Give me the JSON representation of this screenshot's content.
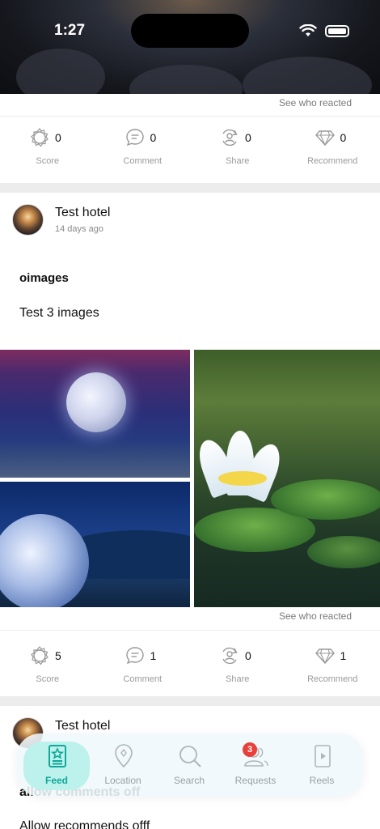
{
  "status_bar": {
    "time": "1:27"
  },
  "post1": {
    "see_who_reacted": "See who reacted",
    "reactions": [
      {
        "label": "Score",
        "count": "0",
        "icon": "score-badge-icon"
      },
      {
        "label": "Comment",
        "count": "0",
        "icon": "comment-icon"
      },
      {
        "label": "Share",
        "count": "0",
        "icon": "share-icon"
      },
      {
        "label": "Recommend",
        "count": "0",
        "icon": "diamond-icon"
      }
    ]
  },
  "post2": {
    "author": "Test hotel",
    "time": "14 days ago",
    "title": "oimages",
    "text": "Test 3 images",
    "see_who_reacted": "See who reacted",
    "reactions": [
      {
        "label": "Score",
        "count": "5",
        "icon": "score-badge-icon"
      },
      {
        "label": "Comment",
        "count": "1",
        "icon": "comment-icon"
      },
      {
        "label": "Share",
        "count": "0",
        "icon": "share-icon"
      },
      {
        "label": "Recommend",
        "count": "1",
        "icon": "diamond-icon"
      }
    ]
  },
  "post3": {
    "author": "Test hotel",
    "title": "allow comments off",
    "text": "Allow recommends offf"
  },
  "bottom_nav": {
    "items": [
      {
        "label": "Feed",
        "icon": "feed-star-icon",
        "active": true
      },
      {
        "label": "Location",
        "icon": "location-pin-icon",
        "active": false
      },
      {
        "label": "Search",
        "icon": "search-icon",
        "active": false
      },
      {
        "label": "Requests",
        "icon": "requests-people-icon",
        "active": false,
        "badge": "3"
      },
      {
        "label": "Reels",
        "icon": "reels-play-icon",
        "active": false
      }
    ]
  },
  "colors": {
    "accent": "#0fa89a",
    "accent_bg": "#bdf2ec",
    "badge": "#e8403a"
  }
}
